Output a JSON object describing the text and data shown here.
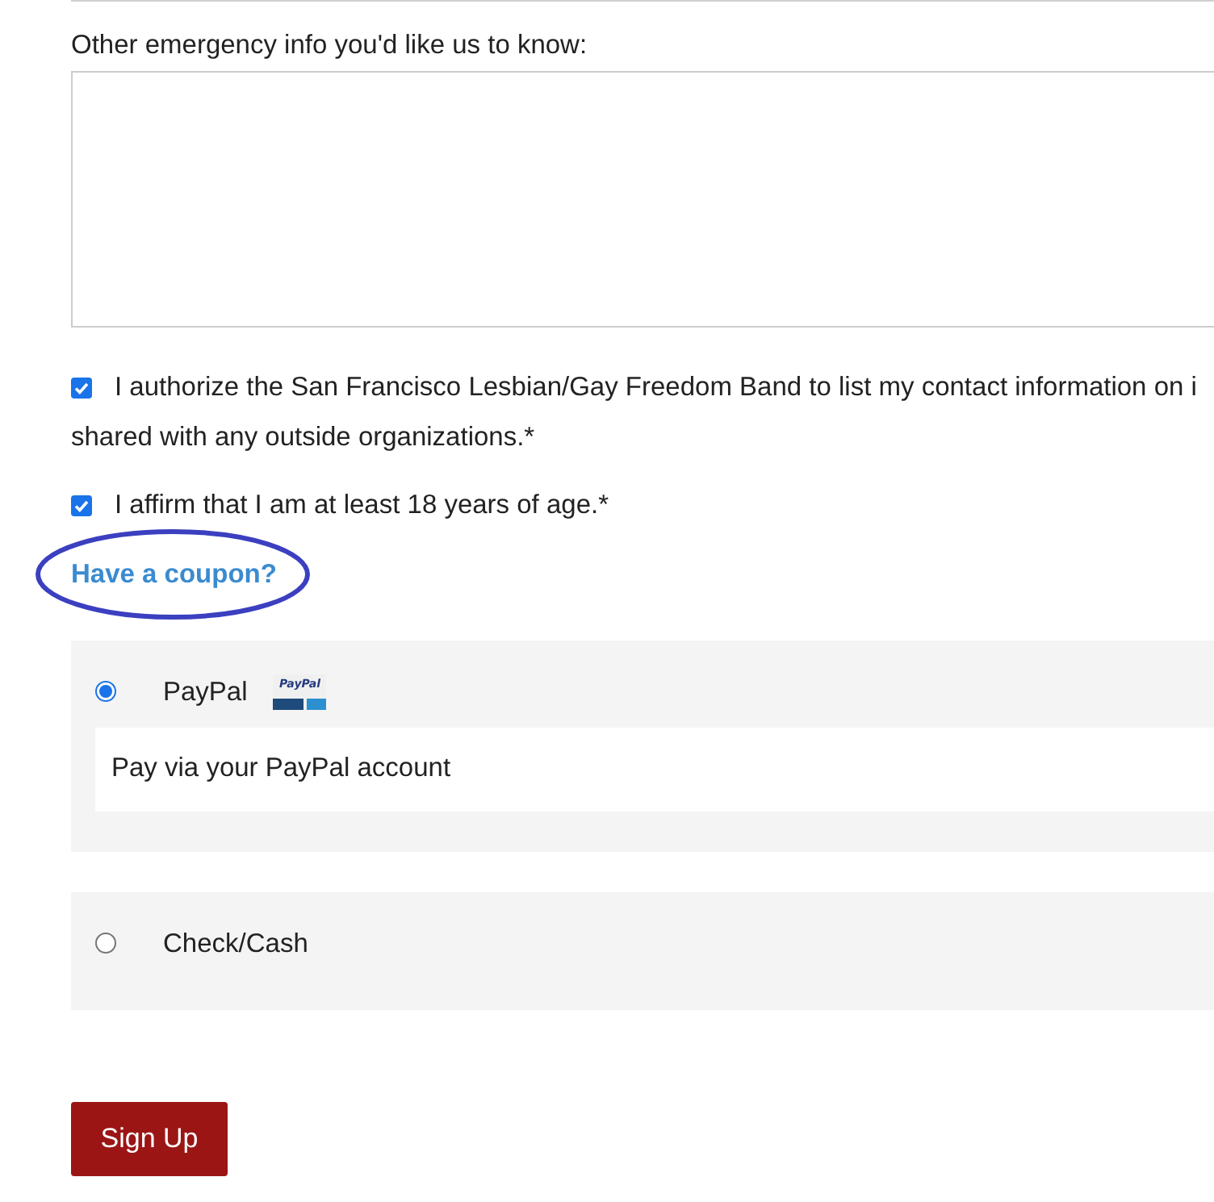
{
  "emergency_info": {
    "label": "Other emergency info you'd like us to know:"
  },
  "agreements": [
    {
      "lines": [
        "I authorize the San Francisco Lesbian/Gay Freedom Band to list my contact information on i",
        "shared with any outside organizations.*"
      ],
      "checked": true
    },
    {
      "lines": [
        "I affirm that I am at least 18 years of age.*"
      ],
      "checked": true
    }
  ],
  "coupon_link": {
    "text": "Have a coupon?",
    "circled": true
  },
  "payment_methods": [
    {
      "name": "PayPal",
      "selected": true,
      "logo_text": "PayPal",
      "description": "Pay via your PayPal account"
    },
    {
      "name": "Check/Cash",
      "selected": false
    }
  ],
  "submit_button": {
    "label": "Sign Up"
  }
}
